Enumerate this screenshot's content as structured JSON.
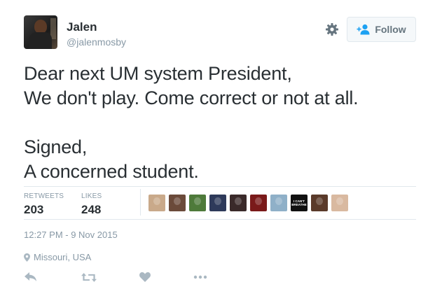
{
  "user": {
    "name": "Jalen",
    "handle": "@jalenmosby"
  },
  "follow_button": {
    "label": "Follow"
  },
  "tweet": {
    "text": "Dear next UM system President,\nWe don't play. Come correct or not at all.\n\nSigned,\nA concerned student."
  },
  "stats": {
    "retweets_label": "RETWEETS",
    "retweets_value": "203",
    "likes_label": "LIKES",
    "likes_value": "248"
  },
  "likers": [
    {
      "icon": "avatar",
      "color": "#c9a98a"
    },
    {
      "icon": "avatar",
      "color": "#6b4a3a"
    },
    {
      "icon": "avatar",
      "color": "#4e7a3a"
    },
    {
      "icon": "avatar",
      "color": "#2e3a5a"
    },
    {
      "icon": "avatar",
      "color": "#3a2a2a"
    },
    {
      "icon": "avatar",
      "color": "#7a1a1a"
    },
    {
      "icon": "avatar",
      "color": "#8fb0c8"
    },
    {
      "icon": "avatar",
      "color": "#111111",
      "text": "I CAN'T BREATHE"
    },
    {
      "icon": "avatar",
      "color": "#5a3a2a"
    },
    {
      "icon": "avatar",
      "color": "#d9b9a0"
    }
  ],
  "timestamp": "12:27 PM - 9 Nov 2015",
  "location": "Missouri, USA",
  "icons": {
    "settings": "gear-icon",
    "follow": "add-user-icon",
    "location": "location-pin-icon",
    "reply": "reply-icon",
    "retweet": "retweet-icon",
    "like": "heart-icon",
    "more": "more-icon"
  },
  "colors": {
    "text": "#292f33",
    "muted": "#8899a6",
    "accent": "#1da1f2",
    "icon": "#aab8c2"
  }
}
